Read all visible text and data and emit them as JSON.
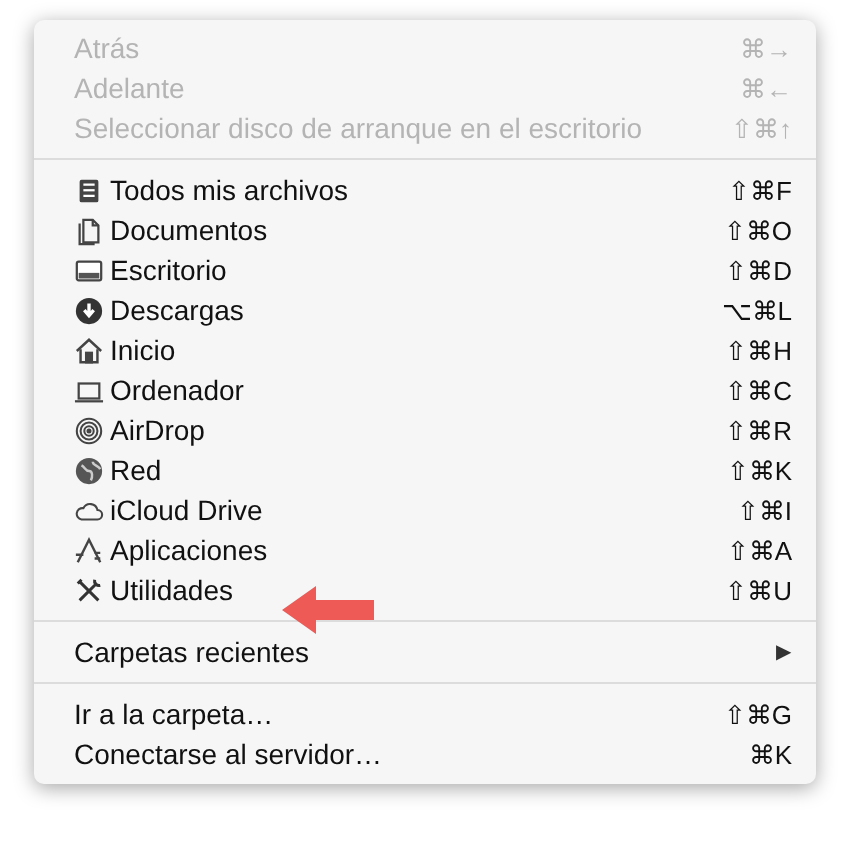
{
  "menu": {
    "groups": [
      {
        "items": [
          {
            "kind": "item",
            "label": "Atrás",
            "shortcut": "⌘→",
            "disabled": true
          },
          {
            "kind": "item",
            "label": "Adelante",
            "shortcut": "⌘←",
            "disabled": true
          },
          {
            "kind": "item",
            "label": "Seleccionar disco de arranque en el escritorio",
            "shortcut": "⇧⌘↑",
            "disabled": true
          }
        ]
      },
      {
        "items": [
          {
            "kind": "item",
            "label": "Todos mis archivos",
            "shortcut": "⇧⌘F",
            "disabled": false
          },
          {
            "kind": "item",
            "label": "Documentos",
            "shortcut": "⇧⌘O",
            "disabled": false
          },
          {
            "kind": "item",
            "label": "Escritorio",
            "shortcut": "⇧⌘D",
            "disabled": false
          },
          {
            "kind": "item",
            "label": "Descargas",
            "shortcut": "⌥⌘L",
            "disabled": false
          },
          {
            "kind": "item",
            "label": "Inicio",
            "shortcut": "⇧⌘H",
            "disabled": false
          },
          {
            "kind": "item",
            "label": "Ordenador",
            "shortcut": "⇧⌘C",
            "disabled": false
          },
          {
            "kind": "item",
            "label": "AirDrop",
            "shortcut": "⇧⌘R",
            "disabled": false
          },
          {
            "kind": "item",
            "label": "Red",
            "shortcut": "⇧⌘K",
            "disabled": false
          },
          {
            "kind": "item",
            "label": "iCloud Drive",
            "shortcut": "⇧⌘I",
            "disabled": false
          },
          {
            "kind": "item",
            "label": "Aplicaciones",
            "shortcut": "⇧⌘A",
            "disabled": false
          },
          {
            "kind": "item",
            "label": "Utilidades",
            "shortcut": "⇧⌘U",
            "disabled": false
          }
        ]
      },
      {
        "items": [
          {
            "kind": "submenu",
            "label": "Carpetas recientes",
            "arrow": "▶",
            "disabled": false
          }
        ]
      },
      {
        "items": [
          {
            "kind": "item",
            "label": "Ir a la carpeta…",
            "shortcut": "⇧⌘G",
            "disabled": false
          },
          {
            "kind": "item",
            "label": "Conectarse al servidor…",
            "shortcut": "⌘K",
            "disabled": false
          }
        ]
      }
    ]
  }
}
